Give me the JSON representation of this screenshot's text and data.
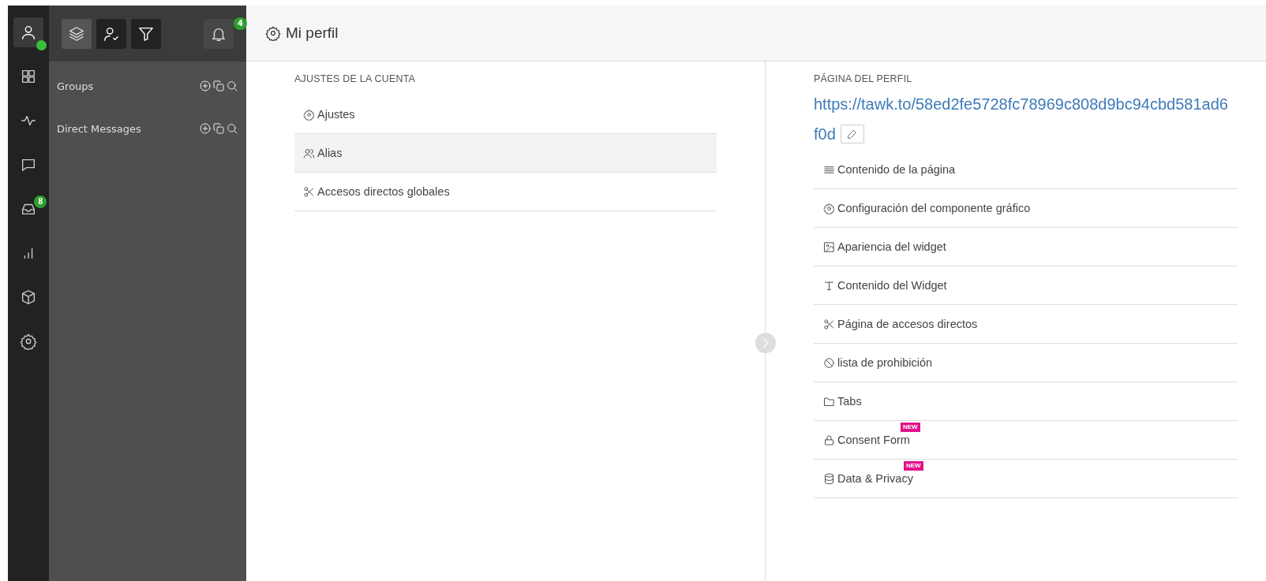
{
  "rail": [
    {
      "selected": true,
      "online": true
    },
    {
      "selected": false
    },
    {
      "selected": false
    },
    {
      "selected": false
    },
    {
      "selected": false,
      "badge": "8"
    },
    {
      "selected": false
    },
    {
      "selected": false
    },
    {
      "selected": false
    }
  ],
  "toolbar": {
    "buttons": [
      {
        "selected": false
      },
      {
        "selected": true
      },
      {
        "selected": true
      }
    ],
    "notifications_badge": "4"
  },
  "panel": {
    "sections": [
      {
        "label": "Groups"
      },
      {
        "label": "Direct Messages"
      }
    ]
  },
  "header": {
    "title": "Mi perfil"
  },
  "account": {
    "heading": "AJUSTES DE LA CUENTA",
    "items": [
      {
        "label": "Ajustes",
        "selected": false
      },
      {
        "label": "Alias",
        "selected": true
      },
      {
        "label": "Accesos directos globales",
        "selected": false
      }
    ]
  },
  "profile": {
    "heading": "PÁGINA DEL PERFIL",
    "url": "https://tawk.to/58ed2fe5728fc78969c808d9bc94cbd581ad6f0d",
    "items": [
      {
        "label": "Contenido de la página"
      },
      {
        "label": "Configuración del componente gráfico"
      },
      {
        "label": "Apariencia del widget"
      },
      {
        "label": "Contenido del Widget"
      },
      {
        "label": "Página de accesos directos"
      },
      {
        "label": "lista de prohibición"
      },
      {
        "label": "Tabs"
      },
      {
        "label": "Consent Form",
        "badge": "NEW"
      },
      {
        "label": "Data & Privacy",
        "badge": "NEW"
      }
    ]
  }
}
